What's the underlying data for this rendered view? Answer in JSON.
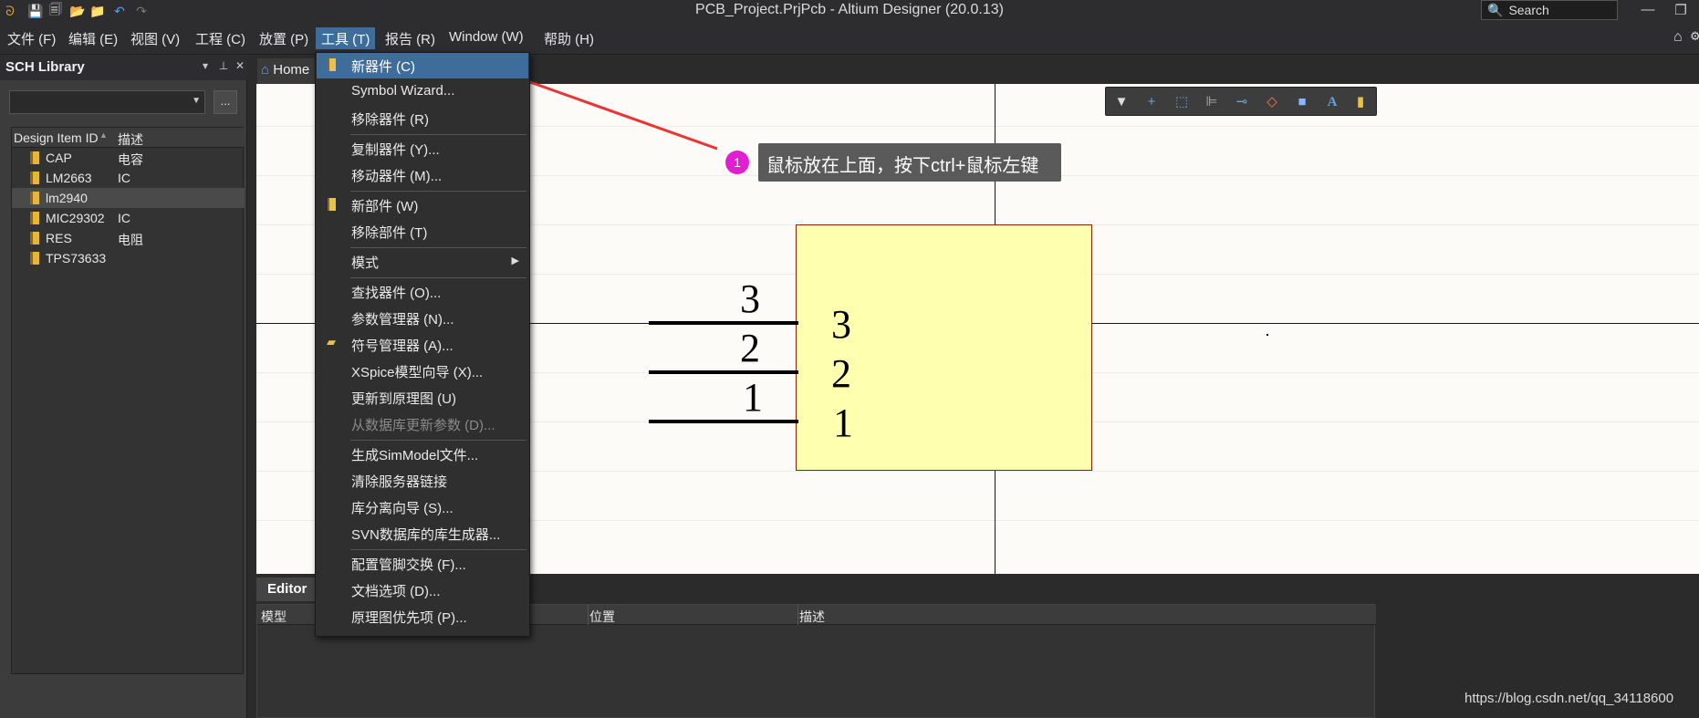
{
  "title_bar": {
    "title": "PCB_Project.PrjPcb - Altium Designer (20.0.13)",
    "search_placeholder": "Search",
    "quick_access": [
      "save-icon",
      "save-all-icon",
      "open-icon",
      "open-project-icon",
      "undo-icon",
      "redo-icon"
    ]
  },
  "menu_bar": {
    "items": [
      {
        "label": "文件 (F)"
      },
      {
        "label": "编辑 (E)"
      },
      {
        "label": "视图 (V)"
      },
      {
        "label": "工程 (C)"
      },
      {
        "label": "放置 (P)"
      },
      {
        "label": "工具 (T)",
        "active": true
      },
      {
        "label": "报告 (R)"
      },
      {
        "label": "Window (W)"
      },
      {
        "label": "帮助 (H)"
      }
    ]
  },
  "sch_library": {
    "title": "SCH Library",
    "more_label": "...",
    "columns": [
      "Design Item ID",
      "描述"
    ],
    "rows": [
      {
        "id": "CAP",
        "desc": "电容"
      },
      {
        "id": "LM2663",
        "desc": "IC"
      },
      {
        "id": "lm2940",
        "desc": "",
        "selected": true
      },
      {
        "id": "MIC29302",
        "desc": "IC"
      },
      {
        "id": "RES",
        "desc": "电阻"
      },
      {
        "id": "TPS73633",
        "desc": ""
      }
    ]
  },
  "tabs": {
    "home": "Home"
  },
  "tools_menu": {
    "items": [
      {
        "label": "新器件 (C)",
        "highlight": true,
        "icon": "component-icon"
      },
      {
        "label": "Symbol Wizard..."
      },
      {
        "label": "移除器件 (R)"
      },
      {
        "sep": true
      },
      {
        "label": "复制器件 (Y)..."
      },
      {
        "label": "移动器件 (M)..."
      },
      {
        "sep": true
      },
      {
        "label": "新部件 (W)",
        "icon": "part-icon"
      },
      {
        "label": "移除部件 (T)"
      },
      {
        "sep": true
      },
      {
        "label": "模式",
        "submenu": true
      },
      {
        "sep": true
      },
      {
        "label": "查找器件 (O)..."
      },
      {
        "label": "参数管理器 (N)..."
      },
      {
        "label": "符号管理器 (A)...",
        "icon": "folder-icon"
      },
      {
        "label": "XSpice模型向导 (X)..."
      },
      {
        "label": "更新到原理图 (U)"
      },
      {
        "label": "从数据库更新参数 (D)...",
        "disabled": true
      },
      {
        "sep": true
      },
      {
        "label": "生成SimModel文件..."
      },
      {
        "label": "清除服务器链接"
      },
      {
        "label": "库分离向导 (S)..."
      },
      {
        "label": "SVN数据库的库生成器..."
      },
      {
        "sep": true
      },
      {
        "label": "配置管脚交换 (F)..."
      },
      {
        "label": "文档选项 (D)..."
      },
      {
        "label": "原理图优先项 (P)..."
      }
    ]
  },
  "annotation": {
    "badge": "1",
    "text": "鼠标放在上面，按下ctrl+鼠标左键",
    "color": "#e020d0"
  },
  "schematic": {
    "pins": [
      {
        "outer": "3",
        "inner": "3"
      },
      {
        "outer": "2",
        "inner": "2"
      },
      {
        "outer": "1",
        "inner": "1"
      }
    ],
    "body_color": "#ffffb0"
  },
  "editor_panel": {
    "tab": "Editor",
    "columns": [
      "模型",
      "位置",
      "描述"
    ]
  },
  "watermark": "https://blog.csdn.net/qq_34118600"
}
